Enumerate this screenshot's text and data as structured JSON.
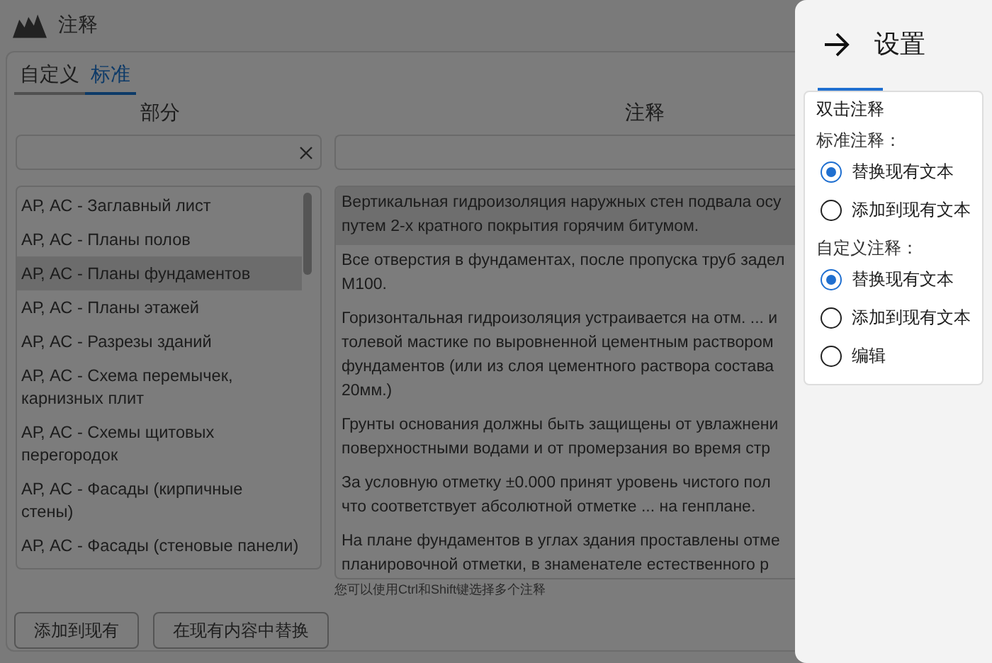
{
  "window": {
    "title": "注释"
  },
  "tabs": [
    {
      "label": "自定义",
      "selected": false
    },
    {
      "label": "标准",
      "selected": true
    }
  ],
  "sections": {
    "header": "部分",
    "items": [
      {
        "label": "АР, АС - Заглавный лист",
        "selected": false
      },
      {
        "label": "АР, АС - Планы полов",
        "selected": false
      },
      {
        "label": "АР, АС - Планы фундаментов",
        "selected": true
      },
      {
        "label": "АР, АС - Планы этажей",
        "selected": false
      },
      {
        "label": "АР, АС - Разрезы зданий",
        "selected": false
      },
      {
        "label": "АР, АС - Схема перемычек, карнизных плит",
        "selected": false
      },
      {
        "label": "АР, АС - Схемы щитовых перегородок",
        "selected": false
      },
      {
        "label": "АР, АС - Фасады (кирпичные стены)",
        "selected": false
      },
      {
        "label": "АР, АС - Фасады (стеновые панели)",
        "selected": false
      }
    ]
  },
  "notes": {
    "header": "注释",
    "items": [
      {
        "lines": [
          "Вертикальная гидроизоляция наружных стен подвала осу",
          "путем 2-х кратного покрытия горячим битумом."
        ],
        "selected": true
      },
      {
        "lines": [
          "Все отверстия в фундаментах, после пропуска труб задел",
          "М100."
        ],
        "selected": false
      },
      {
        "lines": [
          "Горизонтальная гидроизоляция устраивается на отм. ... и",
          "толевой мастике по выровненной цементным раствором",
          "фундаментов (или из слоя цементного раствора состава",
          "20мм.)"
        ],
        "selected": false
      },
      {
        "lines": [
          "Грунты основания должны быть защищены от увлажнени",
          "поверхностными водами и от промерзания во время стр"
        ],
        "selected": false
      },
      {
        "lines": [
          "За условную отметку ±0.000 принят уровень чистого пол",
          "что соответствует абсолютной отметке ... на генплане."
        ],
        "selected": false
      },
      {
        "lines": [
          "На плане фундаментов в углах здания проставлены отме",
          "планировочной отметки, в знаменателе естественного р"
        ],
        "selected": false
      }
    ],
    "hint": "您可以使用Ctrl和Shift键选择多个注释"
  },
  "buttons": [
    "添加到现有",
    "在现有内容中替换"
  ],
  "settings": {
    "title": "设置",
    "section_title": "双击注释",
    "groups": [
      {
        "label": "标准注释：",
        "options": [
          {
            "label": "替换现有文本",
            "selected": true
          },
          {
            "label": "添加到现有文本",
            "selected": false
          }
        ]
      },
      {
        "label": "自定义注释：",
        "options": [
          {
            "label": "替换现有文本",
            "selected": true
          },
          {
            "label": "添加到现有文本",
            "selected": false
          },
          {
            "label": "编辑",
            "selected": false
          }
        ]
      }
    ]
  }
}
